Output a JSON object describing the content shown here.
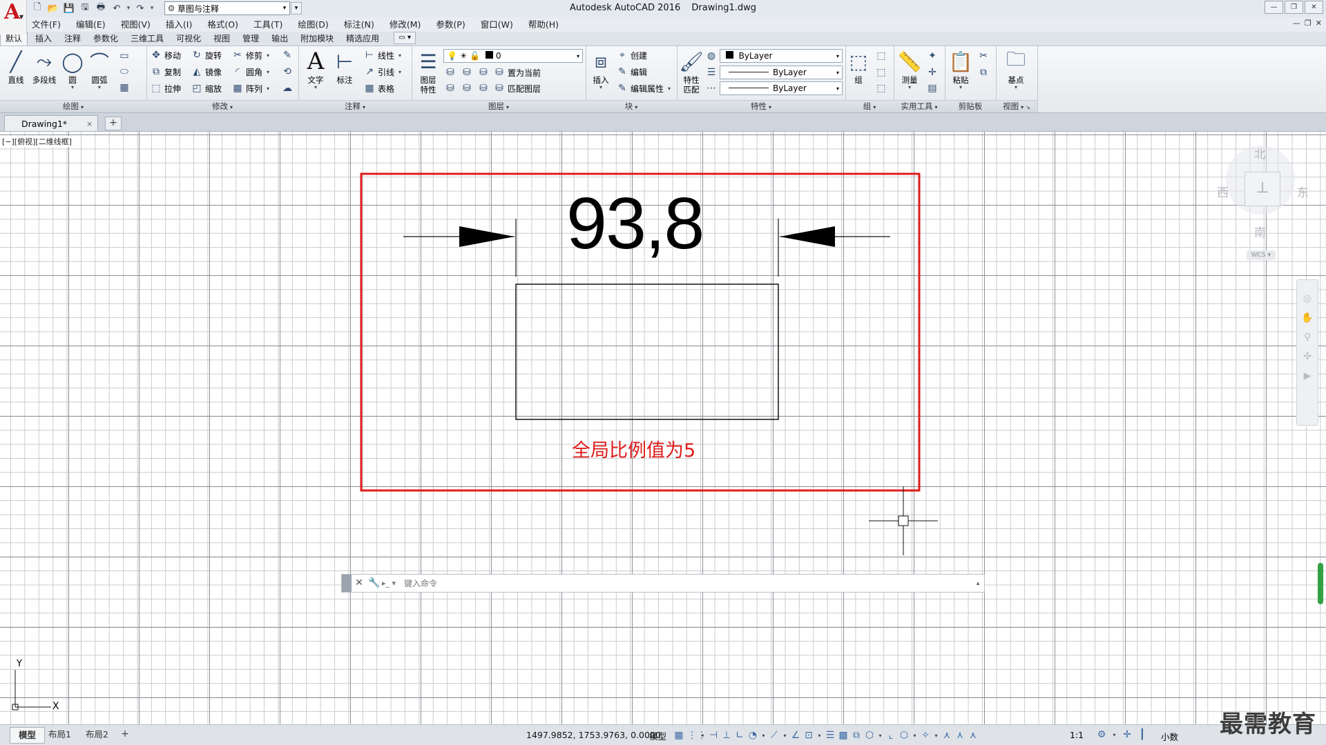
{
  "app": {
    "title": "Autodesk AutoCAD 2016",
    "document_title": "Drawing1.dwg",
    "logo_letter": "A",
    "workspace": "草图与注释"
  },
  "window_controls": [
    "—",
    "❐",
    "✕"
  ],
  "doc_window_controls": [
    "—",
    "❐",
    "✕"
  ],
  "qat": {
    "icons": [
      "new-icon",
      "open-icon",
      "save-icon",
      "save-as-icon",
      "plot-icon",
      "undo-icon",
      "redo-icon"
    ]
  },
  "menu": [
    "文件(F)",
    "编辑(E)",
    "视图(V)",
    "插入(I)",
    "格式(O)",
    "工具(T)",
    "绘图(D)",
    "标注(N)",
    "修改(M)",
    "参数(P)",
    "窗口(W)",
    "帮助(H)"
  ],
  "ribbon_tabs": [
    "默认",
    "插入",
    "注释",
    "参数化",
    "三维工具",
    "可视化",
    "视图",
    "管理",
    "输出",
    "附加模块",
    "精选应用"
  ],
  "ribbon_tab_extra": "▭ ▾",
  "panels": {
    "draw": {
      "title": "绘图",
      "buttons": [
        "直线",
        "多段线",
        "圆",
        "圆弧"
      ]
    },
    "modify": {
      "title": "修改",
      "buttons": [
        "移动",
        "旋转",
        "修剪",
        "复制",
        "镜像",
        "圆角",
        "拉伸",
        "缩放",
        "阵列"
      ]
    },
    "annotation": {
      "title": "注释",
      "buttons": [
        "文字",
        "标注"
      ],
      "small": [
        "线性",
        "引线",
        "表格"
      ]
    },
    "layers": {
      "title": "图层",
      "big": [
        "图层",
        "特性"
      ],
      "layer_name": "0",
      "small": [
        "置为当前",
        "匹配图层"
      ]
    },
    "block": {
      "title": "块",
      "big": "插入",
      "small": [
        "创建",
        "编辑",
        "编辑属性"
      ]
    },
    "properties": {
      "title": "特性",
      "big": [
        "特性",
        "匹配"
      ],
      "color": "ByLayer",
      "linetype": "ByLayer",
      "lineweight": "ByLayer"
    },
    "groups": {
      "title": "组",
      "big": "组"
    },
    "utilities": {
      "title": "实用工具",
      "big": "测量"
    },
    "clipboard": {
      "title": "剪贴板",
      "big": "粘贴"
    },
    "view": {
      "title": "视图",
      "big": "基点"
    }
  },
  "doc_tab": {
    "label": "Drawing1*",
    "close": "×",
    "add": "+"
  },
  "viewport_label": "[−][俯视][二维线框]",
  "drawing": {
    "dimension_text": "93,8",
    "note": "全局比例值为5"
  },
  "viewcube": {
    "north": "北",
    "south": "南",
    "east": "东",
    "west": "西",
    "wcs": "WCS ▾"
  },
  "ucs": {
    "x": "X",
    "y": "Y"
  },
  "command_line": {
    "placeholder": "键入命令"
  },
  "layout_tabs": [
    "模型",
    "布局1",
    "布局2"
  ],
  "layout_add": "+",
  "status": {
    "coordinates": "1497.9852, 1753.9763, 0.0000",
    "model": "模型",
    "scale": "1:1",
    "units": "小数"
  },
  "watermark": "最需教育",
  "colors": {
    "annotation_red": "#e01b1b",
    "autocad_red": "#c8161d"
  }
}
